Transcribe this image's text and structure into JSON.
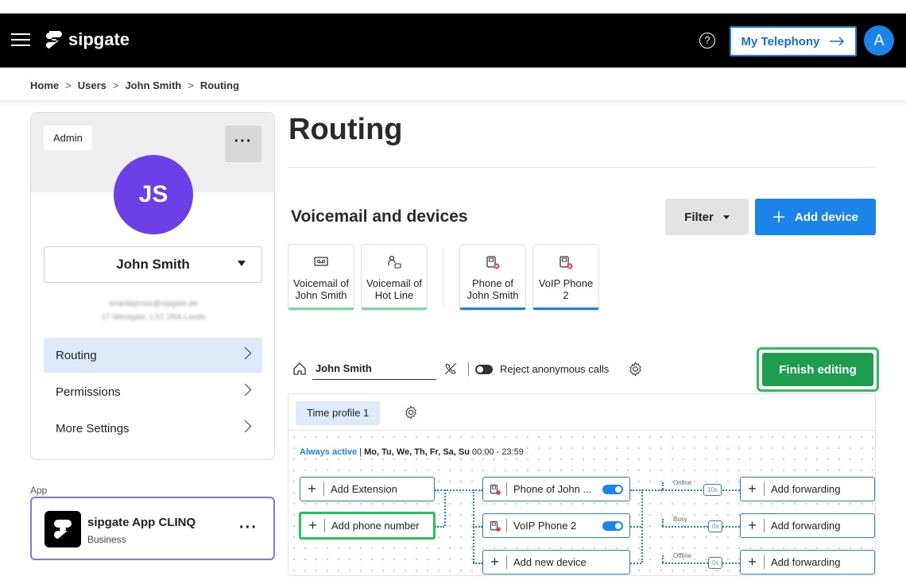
{
  "header": {
    "logo_text": "sipgate",
    "help_symbol": "?",
    "my_telephony_label": "My Telephony",
    "avatar_initial": "A"
  },
  "breadcrumb": [
    "Home",
    "Users",
    "John Smith",
    "Routing"
  ],
  "profile": {
    "badge": "Admin",
    "initials": "JS",
    "name": "John Smith",
    "email_blurred": "brianlaprose@sipgate.de",
    "address_blurred": "17 Westgate, LS1 2RA Leeds",
    "nav": [
      {
        "label": "Routing",
        "active": true
      },
      {
        "label": "Permissions",
        "active": false
      },
      {
        "label": "More Settings",
        "active": false
      }
    ]
  },
  "app_section": {
    "label": "App",
    "name": "sipgate App CLINQ",
    "plan": "Business"
  },
  "main": {
    "title": "Routing",
    "section_title": "Voicemail and devices",
    "filter_label": "Filter",
    "add_device_label": "Add device",
    "devices": [
      {
        "line1": "Voicemail of",
        "line2": "John Smith",
        "icon": "voicemail-icon",
        "bar_color": "#7dd9a0"
      },
      {
        "line1": "Voicemail of",
        "line2": "Hot Line",
        "icon": "voicemail-routing-icon",
        "bar_color": "#7dd9a0"
      },
      {
        "line1": "Phone of",
        "line2": "John Smith",
        "icon": "desk-phone-offline-icon",
        "bar_color": "#1a84e8"
      },
      {
        "line1": "VoIP Phone",
        "line2": "2",
        "icon": "desk-phone-offline-icon",
        "bar_color": "#1a84e8"
      }
    ],
    "routing_target_name": "John Smith",
    "reject_anonymous_label": "Reject anonymous calls",
    "finish_editing_label": "Finish editing",
    "time_profile_tab": "Time profile 1",
    "always_active": "Always active",
    "schedule_days": "Mo, Tu, We, Th, Fr, Sa, Su",
    "schedule_time": "00:00 - 23:59",
    "left_nodes": {
      "add_extension": "Add Extension",
      "add_phone_number": "Add phone number"
    },
    "device_nodes": {
      "phone1": "Phone of John ...",
      "phone2": "VoIP Phone 2",
      "add_new": "Add new device"
    },
    "conditions": [
      {
        "label": "Online",
        "timer": "10s",
        "action": "Add forwarding"
      },
      {
        "label": "Busy",
        "timer": "0s",
        "action": "Add forwarding"
      },
      {
        "label": "Offline",
        "timer": "0s",
        "action": "Add forwarding"
      }
    ]
  },
  "colors": {
    "brand_blue": "#1a84e8",
    "finish_green": "#1f9d4f",
    "avatar_purple": "#6d3fe6"
  }
}
